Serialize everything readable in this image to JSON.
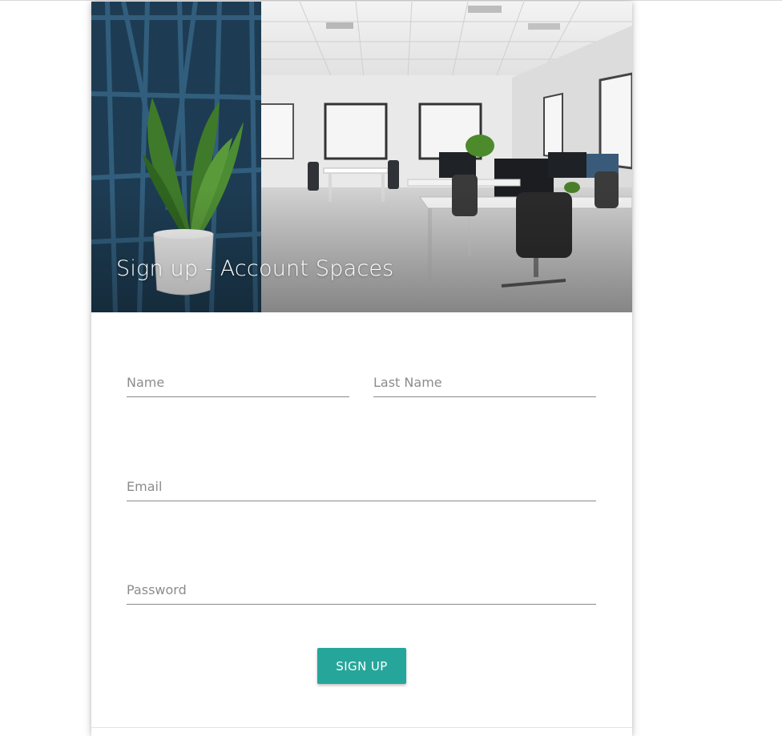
{
  "header": {
    "title": "Sign up - Account Spaces",
    "image": "office-interior-photo"
  },
  "form": {
    "name_placeholder": "Name",
    "last_name_placeholder": "Last Name",
    "email_placeholder": "Email",
    "password_placeholder": "Password",
    "submit_label": "SIGN UP"
  },
  "colors": {
    "accent": "#26a69a",
    "underline": "#8a8a8a",
    "placeholder": "#8c8c8c"
  }
}
